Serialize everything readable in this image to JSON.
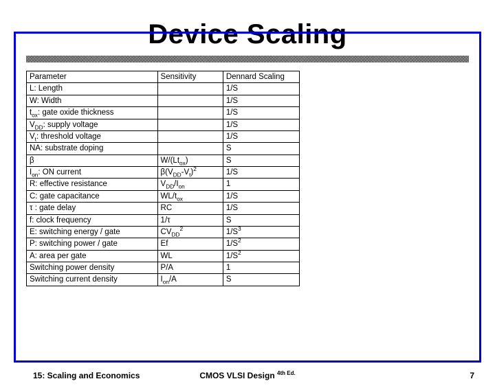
{
  "title": "Device Scaling",
  "table": {
    "headers": [
      "Parameter",
      "Sensitivity",
      "Dennard Scaling"
    ],
    "rows": [
      {
        "param": "L: Length",
        "sens": "",
        "denn": "1/S"
      },
      {
        "param": "W: Width",
        "sens": "",
        "denn": "1/S"
      },
      {
        "param": "t<sub>ox</sub>: gate oxide thickness",
        "sens": "",
        "denn": "1/S"
      },
      {
        "param": "V<sub>DD</sub>: supply voltage",
        "sens": "",
        "denn": "1/S"
      },
      {
        "param": "V<sub>t</sub>: threshold voltage",
        "sens": "",
        "denn": "1/S"
      },
      {
        "param": "NA: substrate doping",
        "sens": "",
        "denn": "S"
      },
      {
        "param": "β",
        "sens": "W/(Lt<sub>ox</sub>)",
        "denn": "S"
      },
      {
        "param": "I<sub>on</sub>: ON current",
        "sens": "β(V<sub>DD</sub>-V<sub>t</sub>)<sup>2</sup>",
        "denn": "1/S"
      },
      {
        "param": "R: effective resistance",
        "sens": "V<sub>DD</sub>/I<sub>on</sub>",
        "denn": "1"
      },
      {
        "param": "C: gate capacitance",
        "sens": "WL/t<sub>ox</sub>",
        "denn": "1/S"
      },
      {
        "param": "τ : gate delay",
        "sens": "RC",
        "denn": "1/S"
      },
      {
        "param": "f: clock frequency",
        "sens": "1/τ",
        "denn": "S"
      },
      {
        "param": "E: switching energy / gate",
        "sens": "CV<sub>DD</sub><sup>2</sup>",
        "denn": "1/S<sup>3</sup>"
      },
      {
        "param": "P: switching power / gate",
        "sens": "Ef",
        "denn": "1/S<sup>2</sup>"
      },
      {
        "param": "A: area per gate",
        "sens": "WL",
        "denn": "1/S<sup>2</sup>"
      },
      {
        "param": "Switching power density",
        "sens": "P/A",
        "denn": "1"
      },
      {
        "param": "Switching current density",
        "sens": "I<sub>on</sub>/A",
        "denn": "S"
      }
    ]
  },
  "footer": {
    "left": "15: Scaling and Economics",
    "center_main": "CMOS VLSI Design",
    "center_ed": "4th Ed.",
    "right": "7"
  }
}
